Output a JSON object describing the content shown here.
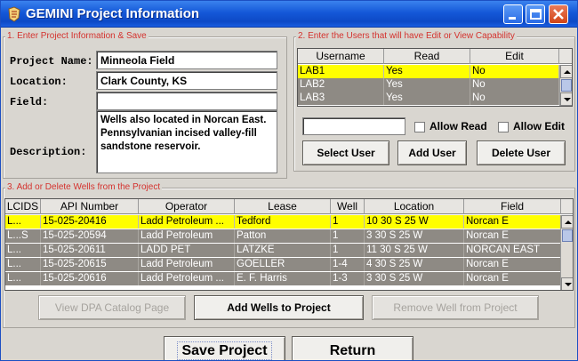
{
  "window": {
    "title": "GEMINI Project Information"
  },
  "project_section": {
    "legend": "1. Enter Project Information & Save",
    "name_label": "Project Name:",
    "name_value": "Minneola Field",
    "location_label": "Location:",
    "location_value": "Clark County, KS",
    "field_label": "Field:",
    "field_value": "",
    "description_label": "Description:",
    "description_value": "Wells also located in Norcan East.\nPennsylvanian incised valley-fill\nsandstone reservoir."
  },
  "users_section": {
    "legend": "2. Enter the Users that will have Edit or View Capability",
    "columns": [
      "Username",
      "Read",
      "Edit"
    ],
    "rows": [
      {
        "username": "LAB1",
        "read": "Yes",
        "edit": "No",
        "selected": true
      },
      {
        "username": "LAB2",
        "read": "Yes",
        "edit": "No",
        "selected": false
      },
      {
        "username": "LAB3",
        "read": "Yes",
        "edit": "No",
        "selected": false
      }
    ],
    "user_input_value": "",
    "allow_read_label": "Allow Read",
    "allow_read_checked": false,
    "allow_edit_label": "Allow Edit",
    "allow_edit_checked": false,
    "select_user_label": "Select User",
    "add_user_label": "Add User",
    "delete_user_label": "Delete User"
  },
  "wells_section": {
    "legend": "3. Add or Delete Wells from the Project",
    "columns": [
      "LCIDS",
      "API Number",
      "Operator",
      "Lease",
      "Well",
      "Location",
      "Field"
    ],
    "rows": [
      {
        "lcids": "L...",
        "api": "15-025-20416",
        "operator": "Ladd Petroleum ...",
        "lease": "Tedford",
        "well": "1",
        "location": "10 30 S 25 W",
        "field": "Norcan E",
        "selected": true
      },
      {
        "lcids": "L...S",
        "api": "15-025-20594",
        "operator": "Ladd Petroleum",
        "lease": "Patton",
        "well": "1",
        "location": "3 30 S 25 W",
        "field": "Norcan E",
        "selected": false
      },
      {
        "lcids": "L...",
        "api": "15-025-20611",
        "operator": "LADD PET",
        "lease": "LATZKE",
        "well": "1",
        "location": "11 30 S 25 W",
        "field": "NORCAN EAST",
        "selected": false
      },
      {
        "lcids": "L...",
        "api": "15-025-20615",
        "operator": "Ladd Petroleum",
        "lease": "GOELLER",
        "well": "1-4",
        "location": "4 30 S 25 W",
        "field": "Norcan E",
        "selected": false
      },
      {
        "lcids": "L...",
        "api": "15-025-20616",
        "operator": "Ladd Petroleum ...",
        "lease": "E. F. Harris",
        "well": "1-3",
        "location": "3 30 S 25 W",
        "field": "Norcan E",
        "selected": false
      }
    ],
    "view_dpa_label": "View DPA Catalog Page",
    "add_wells_label": "Add Wells to Project",
    "remove_well_label": "Remove Well from Project"
  },
  "footer": {
    "save_label": "Save Project",
    "return_label": "Return"
  },
  "colors": {
    "title_bar": "#1458d8",
    "legend_text": "#d4322e",
    "selected_row": "#ffff00",
    "grey_row": "#8e8a84"
  }
}
